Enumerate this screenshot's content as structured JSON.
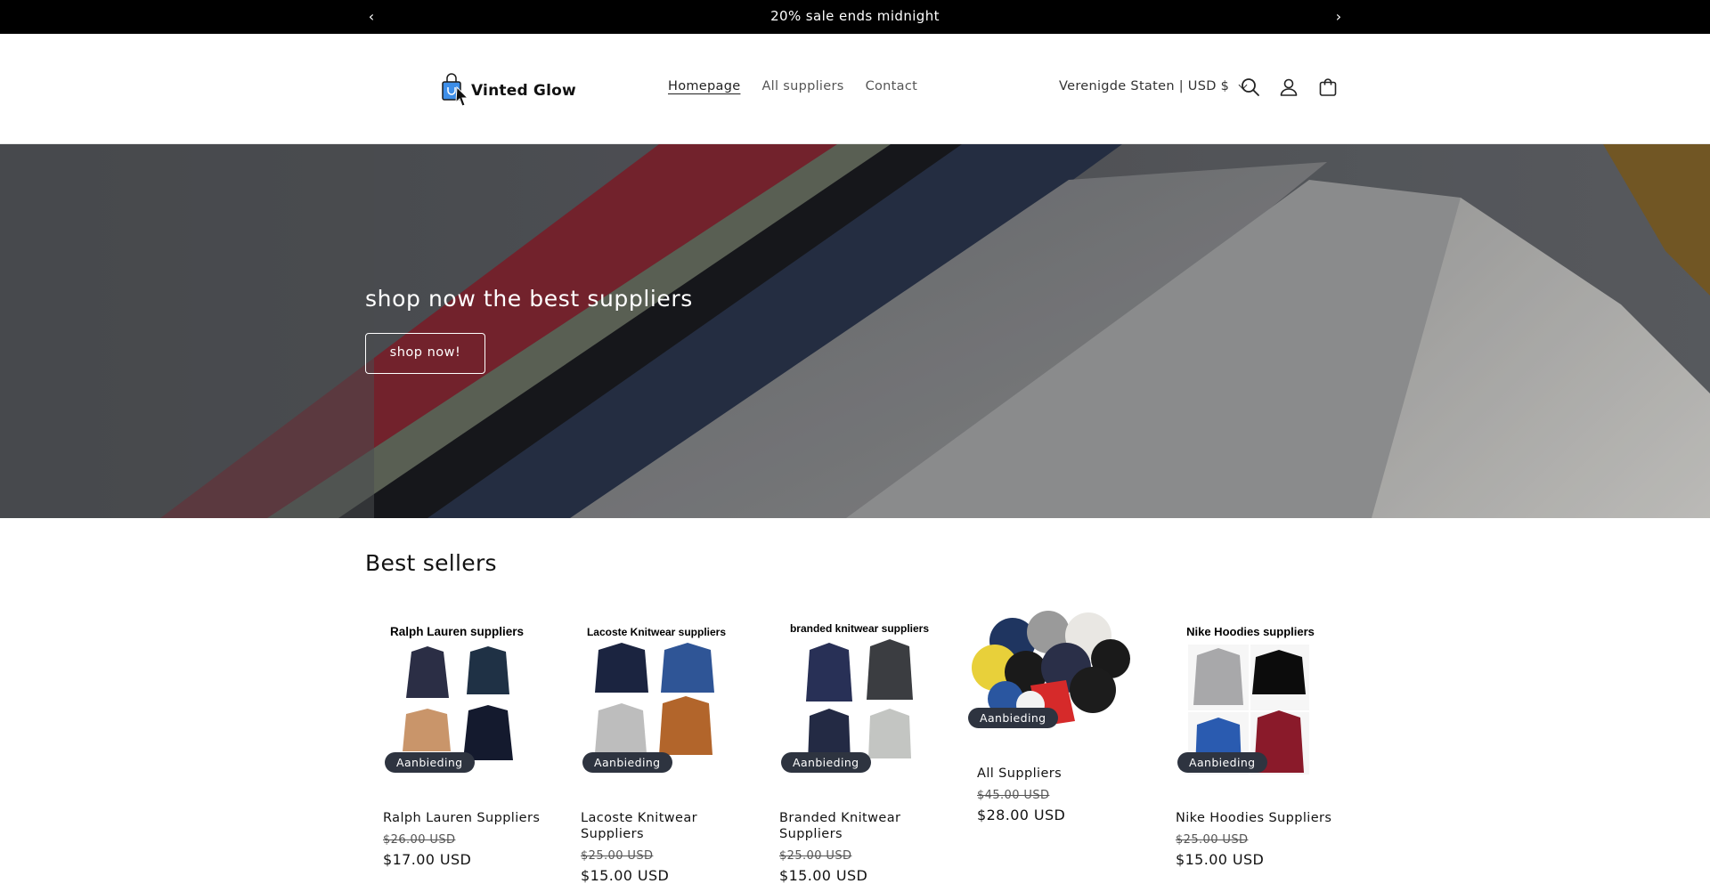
{
  "announcement": {
    "message": "20% sale ends midnight",
    "prev_icon": "chevron-left-icon",
    "next_icon": "chevron-right-icon"
  },
  "header": {
    "logo_text": "Vinted Glow",
    "nav": [
      {
        "label": "Homepage",
        "active": true
      },
      {
        "label": "All suppliers",
        "active": false
      },
      {
        "label": "Contact",
        "active": false
      }
    ],
    "locale": "Verenigde Staten | USD $",
    "icons": [
      "search-icon",
      "account-icon",
      "cart-icon"
    ]
  },
  "hero": {
    "title": "shop now the best suppliers",
    "button": "shop now!"
  },
  "best_sellers": {
    "title": "Best sellers",
    "badge": "Aanbieding",
    "products": [
      {
        "image_title": "Ralph Lauren suppliers",
        "name": "Ralph Lauren Suppliers",
        "old_price": "$26.00 USD",
        "price": "$17.00 USD"
      },
      {
        "image_title": "Lacoste Knitwear suppliers",
        "name": "Lacoste Knitwear Suppliers",
        "old_price": "$25.00 USD",
        "price": "$15.00 USD"
      },
      {
        "image_title": "branded knitwear suppliers",
        "name": "Branded Knitwear Suppliers",
        "old_price": "$25.00 USD",
        "price": "$15.00 USD"
      },
      {
        "image_title": "",
        "name": "All Suppliers",
        "old_price": "$45.00 USD",
        "price": "$28.00 USD"
      },
      {
        "image_title": "Nike Hoodies suppliers",
        "name": "Nike Hoodies Suppliers",
        "old_price": "$25.00 USD",
        "price": "$15.00 USD"
      }
    ]
  },
  "colors": {
    "announcement_bg": "#000000",
    "badge_bg": "#2e3440",
    "text": "#121212"
  }
}
